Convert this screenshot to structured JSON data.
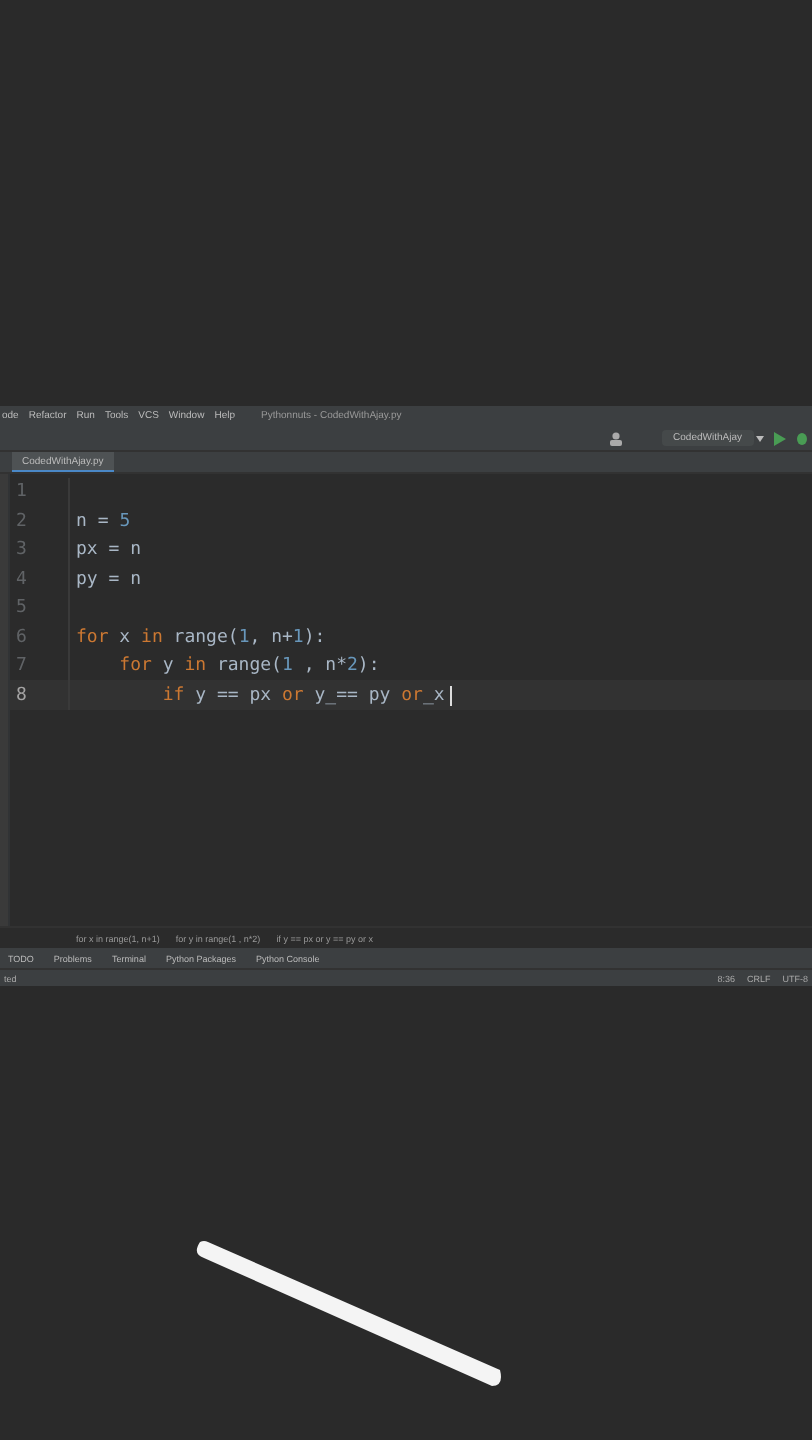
{
  "menu_bar": {
    "items": [
      "ode",
      "Refactor",
      "Run",
      "Tools",
      "VCS",
      "Window",
      "Help"
    ],
    "title": "Pythonnuts - CodedWithAjay.py"
  },
  "toolbar": {
    "run_configuration": "CodedWithAjay"
  },
  "tabs": [
    {
      "label": "CodedWithAjay.py",
      "selected": true
    }
  ],
  "editor": {
    "lines": [
      {
        "number": "1",
        "current": false
      },
      {
        "number": "2",
        "current": false,
        "tokens": [
          {
            "text": "n = ",
            "kind": "name"
          },
          {
            "text": "5",
            "kind": "number"
          }
        ]
      },
      {
        "number": "3",
        "current": false,
        "tokens": [
          {
            "text": "px = n",
            "kind": "name"
          }
        ]
      },
      {
        "number": "4",
        "current": false,
        "tokens": [
          {
            "text": "py = n",
            "kind": "name"
          }
        ]
      },
      {
        "number": "5",
        "current": false
      },
      {
        "number": "6",
        "current": false,
        "tokens": [
          {
            "text": "for",
            "kind": "keyword"
          },
          {
            "text": " x ",
            "kind": "name"
          },
          {
            "text": "in",
            "kind": "keyword"
          },
          {
            "text": " range(",
            "kind": "name"
          },
          {
            "text": "1",
            "kind": "number"
          },
          {
            "text": ", n+",
            "kind": "name"
          },
          {
            "text": "1",
            "kind": "number"
          },
          {
            "text": "):",
            "kind": "name"
          }
        ],
        "children": [
          {
            "number": "7",
            "current": false,
            "tokens": [
              {
                "text": "for",
                "kind": "keyword"
              },
              {
                "text": " y ",
                "kind": "name"
              },
              {
                "text": "in",
                "kind": "keyword"
              },
              {
                "text": " range(",
                "kind": "name"
              },
              {
                "text": "1",
                "kind": "number"
              },
              {
                "text": " , n*",
                "kind": "name"
              },
              {
                "text": "2",
                "kind": "number"
              },
              {
                "text": "):",
                "kind": "name"
              }
            ],
            "children": [
              {
                "number": "8",
                "current": true,
                "tokens": [
                  {
                    "text": "if",
                    "kind": "keyword"
                  },
                  {
                    "text": " y == px ",
                    "kind": "name"
                  },
                  {
                    "text": "or",
                    "kind": "keyword"
                  },
                  {
                    "text": " y_== py ",
                    "kind": "name"
                  },
                  {
                    "text": "or",
                    "kind": "keyword"
                  },
                  {
                    "text": "_x",
                    "kind": "name"
                  }
                ]
              }
            ]
          }
        ]
      }
    ]
  },
  "breadcrumbs": [
    "for x in range(1, n+1)",
    "for y in range(1 , n*2)",
    "if y == px or y == py or x"
  ],
  "tool_windows": [
    "TODO",
    "Problems",
    "Terminal",
    "Python Packages",
    "Python Console"
  ],
  "status_bar": {
    "left": "ted",
    "right": [
      "8:36",
      "CRLF",
      "UTF-8"
    ]
  }
}
